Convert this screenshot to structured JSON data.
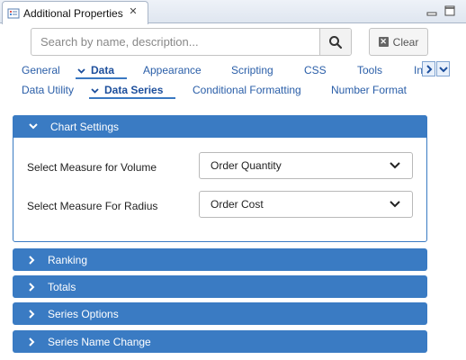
{
  "window": {
    "title": "Additional Properties",
    "close_glyph": "✕"
  },
  "search": {
    "placeholder": "Search by name, description...",
    "clear_label": "Clear",
    "clear_glyph": "✕"
  },
  "tabs_primary": [
    {
      "label": "General",
      "active": false
    },
    {
      "label": "Data",
      "active": true
    },
    {
      "label": "Appearance",
      "active": false
    },
    {
      "label": "Scripting",
      "active": false
    },
    {
      "label": "CSS",
      "active": false
    },
    {
      "label": "Tools",
      "active": false
    },
    {
      "label": "In",
      "active": false
    }
  ],
  "tabs_secondary": [
    {
      "label": "Data Utility",
      "active": false
    },
    {
      "label": "Data Series",
      "active": true
    },
    {
      "label": "Conditional Formatting",
      "active": false
    },
    {
      "label": "Number Format",
      "active": false
    }
  ],
  "chart_settings": {
    "title": "Chart Settings",
    "expanded": true,
    "fields": [
      {
        "label": "Select Measure for Volume",
        "value": "Order Quantity"
      },
      {
        "label": "Select Measure For Radius",
        "value": "Order Cost"
      }
    ]
  },
  "collapsed_sections": [
    {
      "title": "Ranking"
    },
    {
      "title": "Totals"
    },
    {
      "title": "Series Options"
    },
    {
      "title": "Series Name Change"
    }
  ],
  "colors": {
    "accent": "#3a7bc3",
    "tab_text": "#2a5ea8"
  }
}
